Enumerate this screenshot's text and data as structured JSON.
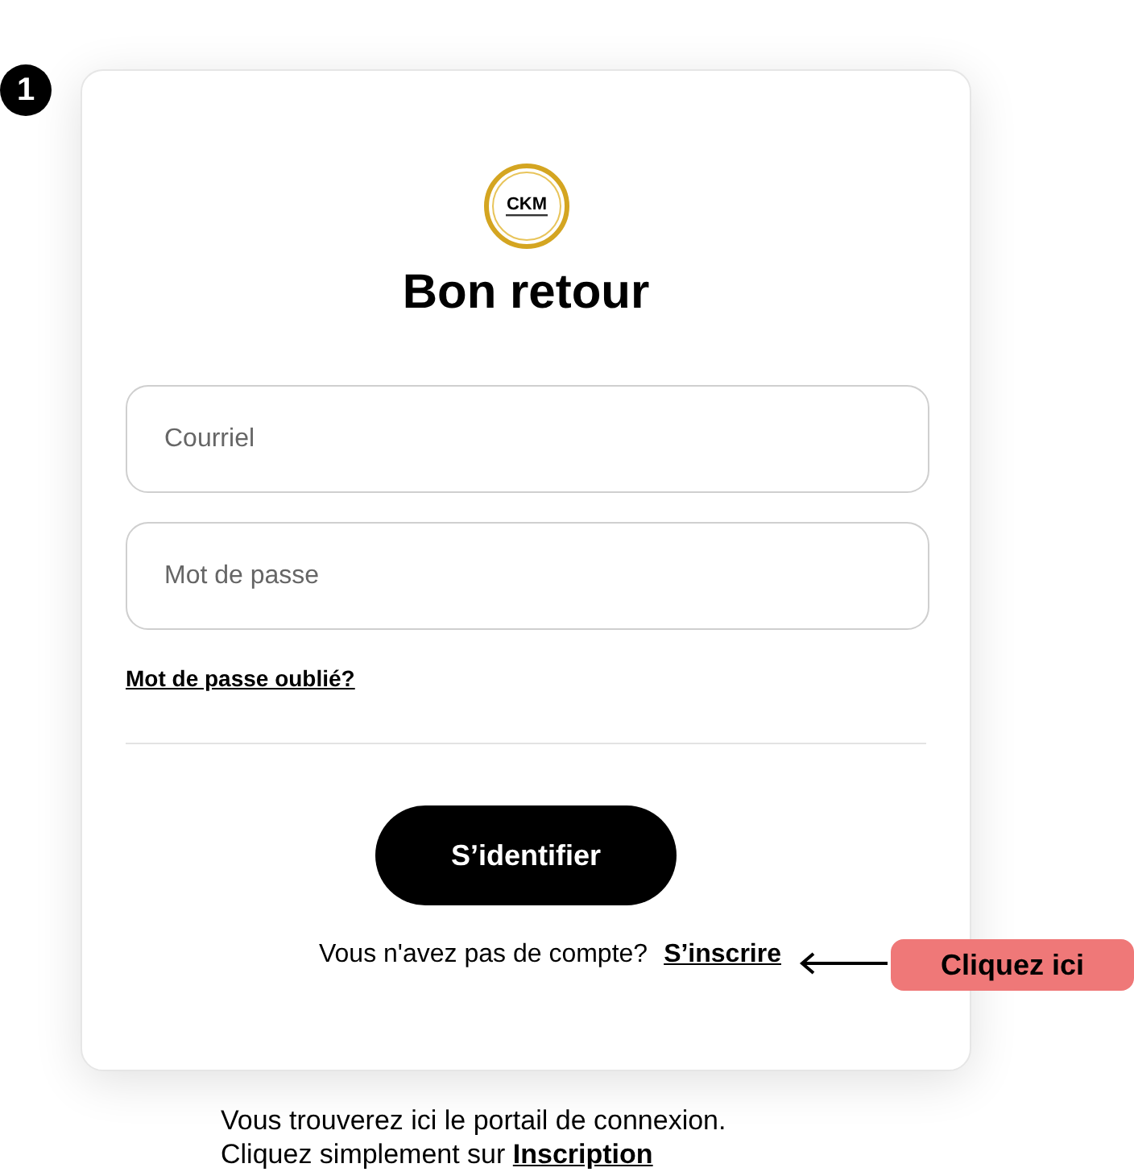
{
  "step_badge": "1",
  "logo": {
    "title": "CKM"
  },
  "heading": "Bon retour",
  "fields": [
    {
      "placeholder": "Courriel"
    },
    {
      "placeholder": "Mot de passe"
    }
  ],
  "forgot_link": "Mot de passe oublié?",
  "submit_button": "S’identifier",
  "signup": {
    "question": "Vous n'avez pas de compte?",
    "link": "S’inscrire"
  },
  "callout": "Cliquez ici",
  "caption": [
    "Vous trouverez ici le portail de connexion.",
    "Cliquez simplement sur **Inscription**"
  ]
}
